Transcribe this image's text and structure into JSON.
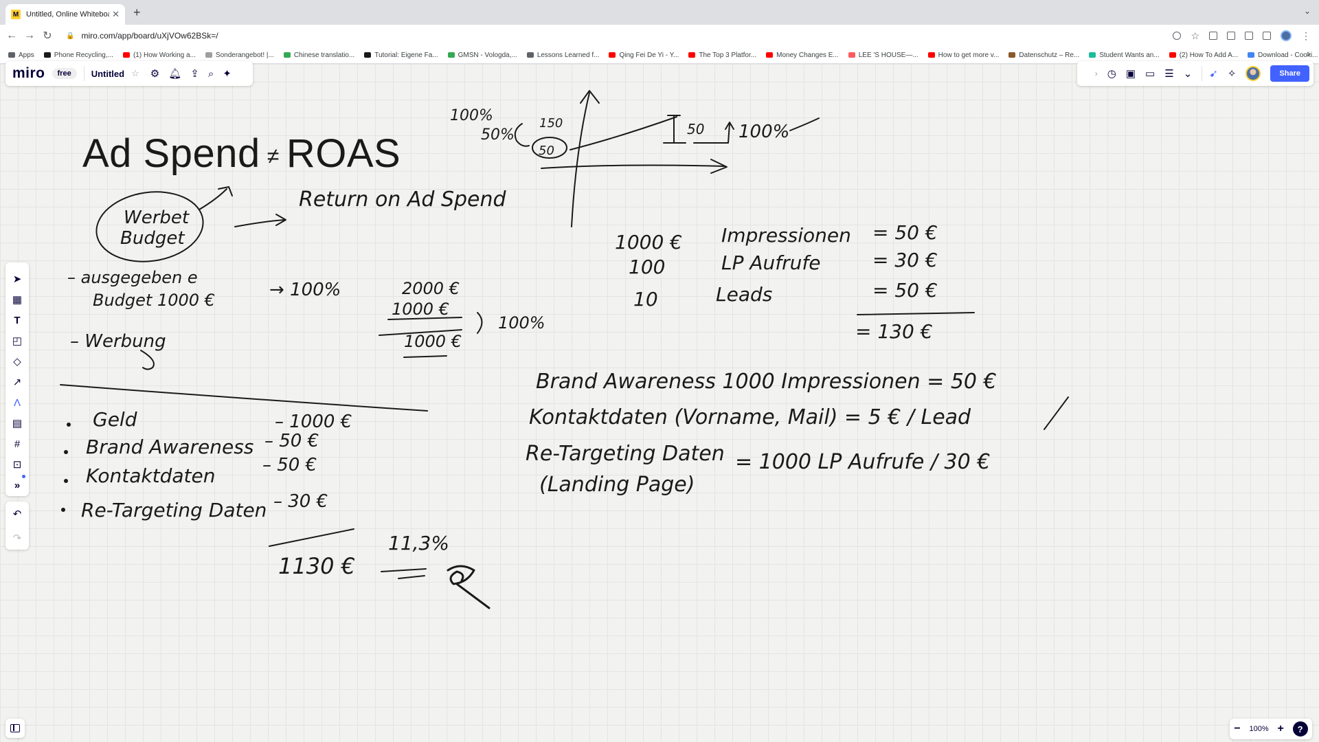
{
  "browser": {
    "tab_title": "Untitled, Online Whiteboard for",
    "url": "miro.com/app/board/uXjVOw62BSk=/",
    "bookmarks": [
      {
        "label": "Apps",
        "color": "#5f6368"
      },
      {
        "label": "Phone Recycling,...",
        "color": "#1a1a1a"
      },
      {
        "label": "(1) How Working a...",
        "color": "#ff0000"
      },
      {
        "label": "Sonderangebot! |...",
        "color": "#9e9e9e"
      },
      {
        "label": "Chinese translatio...",
        "color": "#34a853"
      },
      {
        "label": "Tutorial: Eigene Fa...",
        "color": "#1a1a1a"
      },
      {
        "label": "GMSN - Vologda,...",
        "color": "#34a853"
      },
      {
        "label": "Lessons Learned f...",
        "color": "#5f6368"
      },
      {
        "label": "Qing Fei De Yi - Y...",
        "color": "#ff0000"
      },
      {
        "label": "The Top 3 Platfor...",
        "color": "#ff0000"
      },
      {
        "label": "Money Changes E...",
        "color": "#ff0000"
      },
      {
        "label": "LEE 'S HOUSE—...",
        "color": "#ff5a5f"
      },
      {
        "label": "How to get more v...",
        "color": "#ff0000"
      },
      {
        "label": "Datenschutz – Re...",
        "color": "#8a5a2b"
      },
      {
        "label": "Student Wants an...",
        "color": "#1abc9c"
      },
      {
        "label": "(2) How To Add A...",
        "color": "#ff0000"
      },
      {
        "label": "Download - Cooki...",
        "color": "#4285f4"
      }
    ]
  },
  "miro": {
    "logo": "miro",
    "plan": "free",
    "board_title": "Untitled",
    "share_label": "Share",
    "zoom": "100%"
  },
  "board": {
    "heading_left": "Ad Spend",
    "heading_mark": "≠",
    "heading_right": "ROAS",
    "notes": {
      "circle_label_1": "Werbet",
      "circle_label_2": "Budget",
      "return_on": "Return on Ad Spend",
      "graph_100": "100%",
      "graph_50": "50%",
      "graph_150": "150",
      "graph_50b": "50",
      "graph_50c": "50",
      "graph_right": "100%",
      "bullet1_a": "– ausgegeben e",
      "bullet1_b": "Budget 1000 €",
      "arrow_100": "→ 100%",
      "calc_2000": "2000 €",
      "calc_1000": "1000 €",
      "calc_100pct": "100%",
      "calc_result": "1000 €",
      "bullet2": "– Werbung",
      "r1_amount": "1000 €",
      "r1_label": "Impressionen",
      "r1_value": "= 50 €",
      "r2_amount": "100",
      "r2_label": "LP Aufrufe",
      "r2_value": "= 30 €",
      "r3_amount": "10",
      "r3_label": "Leads",
      "r3_value": "= 50 €",
      "r_total": "= 130 €",
      "list_geld": "Geld",
      "list_geld_v": "– 1000 €",
      "list_brand": "Brand Awareness",
      "list_brand_v": "– 50 €",
      "list_kontakt": "Kontaktdaten",
      "list_kontakt_v": "– 50 €",
      "list_retarg": "Re-Targeting Daten",
      "list_retarg_v": "– 30 €",
      "list_total": "1130 €",
      "list_pct": "11,3%",
      "d1": "Brand Awareness 1000 Impressionen = 50 €",
      "d2": "Kontaktdaten (Vorname, Mail) = 5 € / Lead",
      "d3a": "Re-Targeting Daten",
      "d3b": "(Landing Page)",
      "d3c": "= 1000 LP Aufrufe / 30 €"
    }
  }
}
